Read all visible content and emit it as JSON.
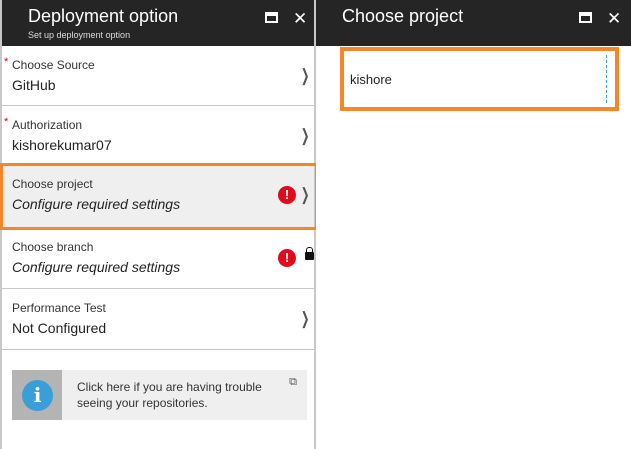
{
  "left_panel": {
    "title": "Deployment option",
    "subtitle": "Set up deployment option",
    "rows": [
      {
        "label": "Choose Source",
        "value": "GitHub",
        "required": true
      },
      {
        "label": "Authorization",
        "value": "kishorekumar07",
        "required": true
      },
      {
        "label": "Choose project",
        "value": "Configure required settings",
        "status": "error"
      },
      {
        "label": "Choose branch",
        "value": "Configure required settings",
        "status": "error-locked"
      },
      {
        "label": "Performance Test",
        "value": "Not Configured"
      }
    ],
    "info": {
      "text": "Click here if you are having trouble seeing your repositories."
    }
  },
  "right_panel": {
    "title": "Choose project",
    "input_value": "kishore"
  },
  "icons": {
    "maximize": "▭",
    "close": "✕",
    "chevron": "❯",
    "error": "!",
    "info": "i",
    "external": "⧉",
    "required": "*"
  },
  "colors": {
    "header": "#252525",
    "highlight": "#f5862a",
    "error": "#e00b1c",
    "info": "#3a9fd8"
  }
}
